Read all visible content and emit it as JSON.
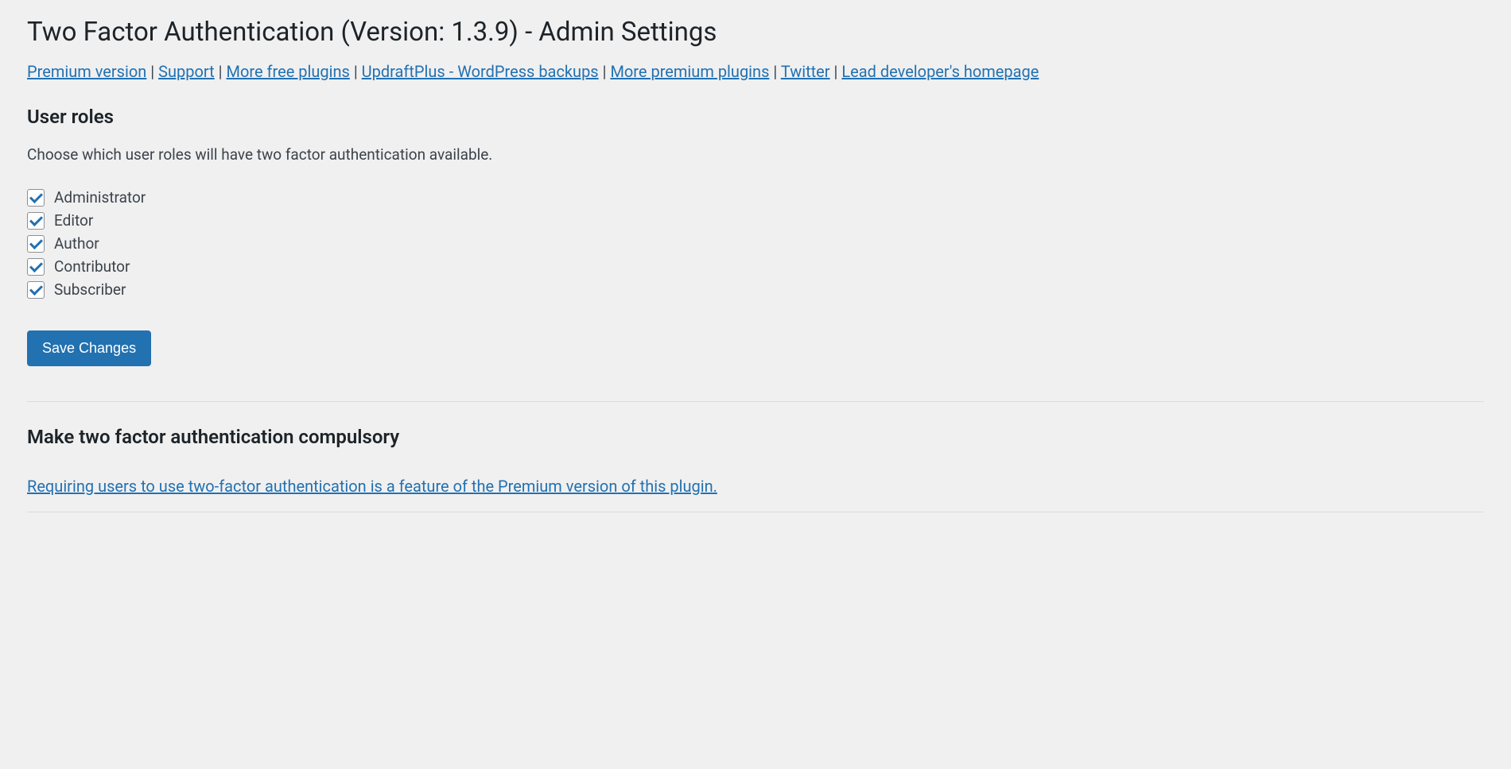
{
  "page": {
    "title": "Two Factor Authentication (Version: 1.3.9) - Admin Settings"
  },
  "headerLinks": {
    "separator": " | ",
    "items": [
      "Premium version",
      "Support",
      "More free plugins",
      "UpdraftPlus - WordPress backups",
      "More premium plugins",
      "Twitter",
      "Lead developer's homepage"
    ]
  },
  "userRoles": {
    "heading": "User roles",
    "description": "Choose which user roles will have two factor authentication available.",
    "items": [
      {
        "label": "Administrator",
        "checked": true
      },
      {
        "label": "Editor",
        "checked": true
      },
      {
        "label": "Author",
        "checked": true
      },
      {
        "label": "Contributor",
        "checked": true
      },
      {
        "label": "Subscriber",
        "checked": true
      }
    ]
  },
  "actions": {
    "saveLabel": "Save Changes"
  },
  "compulsory": {
    "heading": "Make two factor authentication compulsory",
    "premiumText": "Requiring users to use two-factor authentication is a feature of the Premium version of this plugin."
  }
}
